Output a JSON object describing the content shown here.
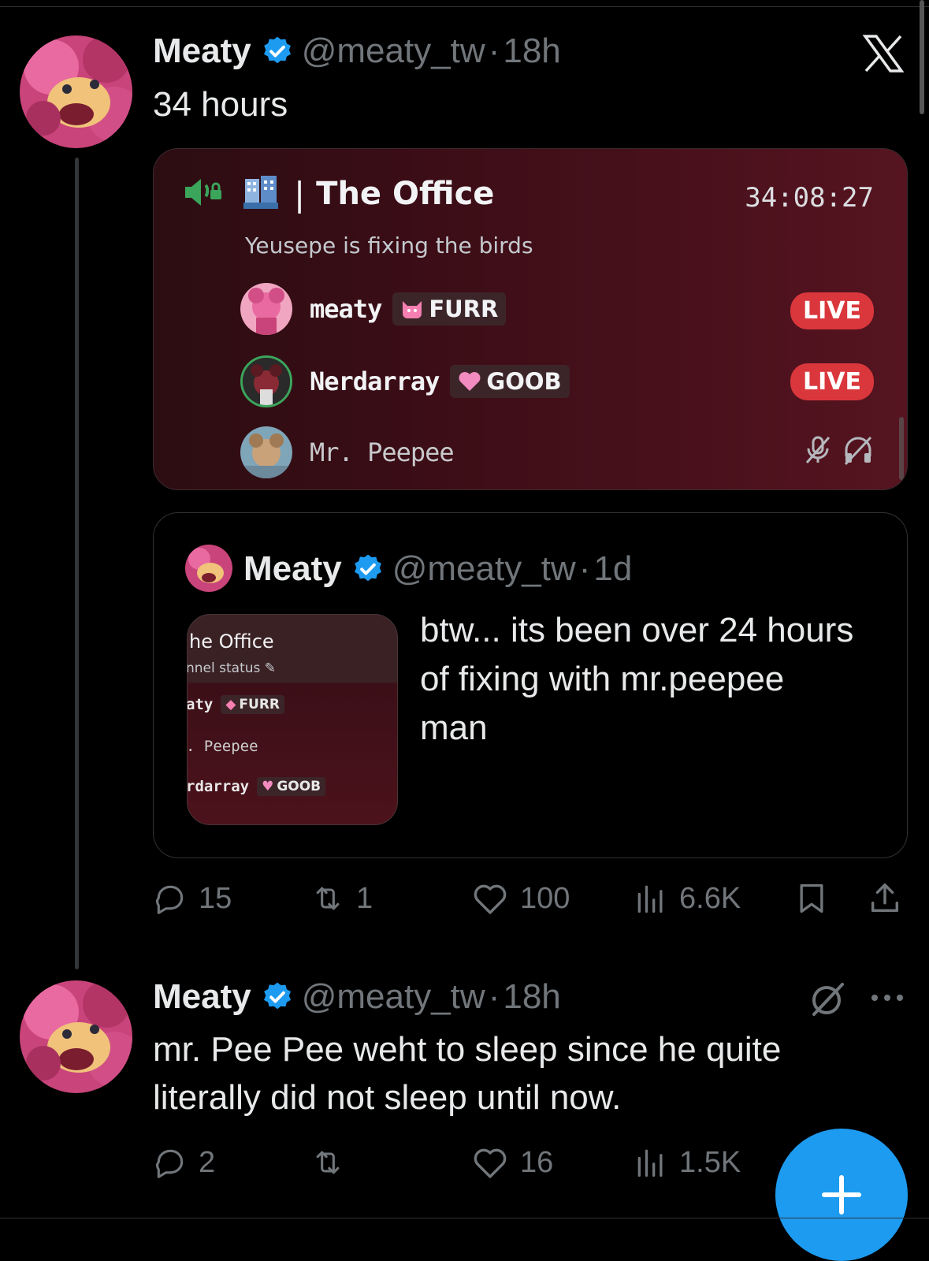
{
  "tweet1": {
    "name": "Meaty",
    "handle": "@meaty_tw",
    "dot": "·",
    "time": "18h",
    "text": "34 hours",
    "discord": {
      "channel_name": "The Office",
      "separator": "|",
      "timer": "34:08:27",
      "status": "Yeusepe is fixing the birds",
      "users": [
        {
          "name": "meaty",
          "tag": "FURR",
          "tag_icon": "cat-icon",
          "live": "LIVE"
        },
        {
          "name": "Nerdarray",
          "tag": "GOOB",
          "tag_icon": "heart-icon",
          "live": "LIVE"
        },
        {
          "name": "Mr. Peepee",
          "muted": true
        }
      ]
    },
    "quote": {
      "name": "Meaty",
      "handle": "@meaty_tw",
      "dot": "·",
      "time": "1d",
      "text": "btw... its been over 24 hours of fixing with mr.peepee man",
      "thumb": {
        "title": "he Office",
        "subtitle": "nnel status",
        "rows": [
          {
            "name": "aty",
            "tag": "FURR"
          },
          {
            "name": ". Peepee"
          },
          {
            "name": "rdarray",
            "tag": "GOOB"
          }
        ]
      }
    },
    "stats": {
      "replies": "15",
      "reposts": "1",
      "likes": "100",
      "views": "6.6K"
    }
  },
  "tweet2": {
    "name": "Meaty",
    "handle": "@meaty_tw",
    "dot": "·",
    "time": "18h",
    "text_line1": "mr. Pee Pee weht to sleep since he quite",
    "text_line2": "literally did not sleep until now.",
    "stats": {
      "replies": "2",
      "reposts": "",
      "likes": "16",
      "views": "1.5K"
    }
  },
  "colors": {
    "accent": "#1d9bf0",
    "live": "#da373c",
    "muted_text": "#71767b"
  }
}
